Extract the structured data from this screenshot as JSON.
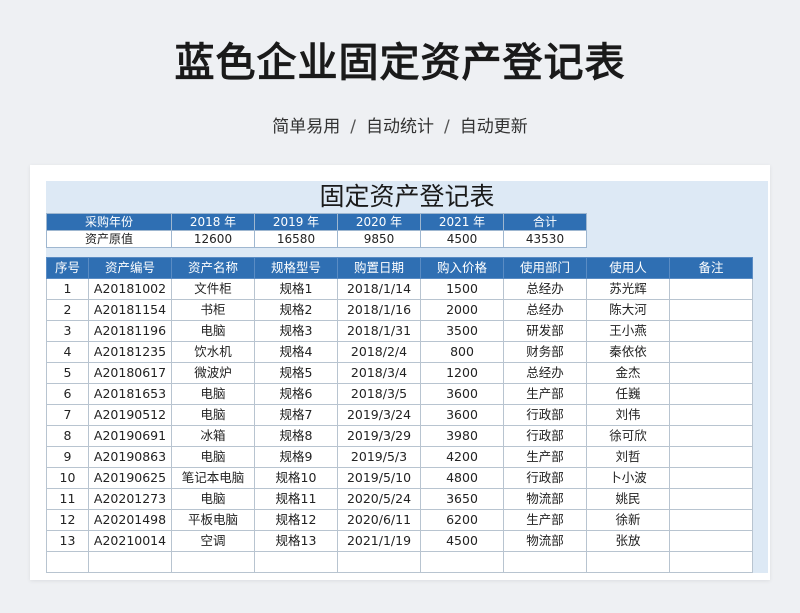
{
  "header": {
    "title": "蓝色企业固定资产登记表",
    "subtitle_parts": [
      "简单易用",
      "自动统计",
      "自动更新"
    ],
    "separator": "/"
  },
  "sheet": {
    "title": "固定资产登记表",
    "summary": {
      "header": [
        "采购年份",
        "2018 年",
        "2019 年",
        "2020 年",
        "2021 年",
        "合计"
      ],
      "values": [
        "资产原值",
        "12600",
        "16580",
        "9850",
        "4500",
        "43530"
      ]
    },
    "table": {
      "columns": [
        "序号",
        "资产编号",
        "资产名称",
        "规格型号",
        "购置日期",
        "购入价格",
        "使用部门",
        "使用人",
        "备注"
      ],
      "rows": [
        [
          "1",
          "A20181002",
          "文件柜",
          "规格1",
          "2018/1/14",
          "1500",
          "总经办",
          "苏光辉",
          ""
        ],
        [
          "2",
          "A20181154",
          "书柜",
          "规格2",
          "2018/1/16",
          "2000",
          "总经办",
          "陈大河",
          ""
        ],
        [
          "3",
          "A20181196",
          "电脑",
          "规格3",
          "2018/1/31",
          "3500",
          "研发部",
          "王小燕",
          ""
        ],
        [
          "4",
          "A20181235",
          "饮水机",
          "规格4",
          "2018/2/4",
          "800",
          "财务部",
          "秦依依",
          ""
        ],
        [
          "5",
          "A20180617",
          "微波炉",
          "规格5",
          "2018/3/4",
          "1200",
          "总经办",
          "金杰",
          ""
        ],
        [
          "6",
          "A20181653",
          "电脑",
          "规格6",
          "2018/3/5",
          "3600",
          "生产部",
          "任巍",
          ""
        ],
        [
          "7",
          "A20190512",
          "电脑",
          "规格7",
          "2019/3/24",
          "3600",
          "行政部",
          "刘伟",
          ""
        ],
        [
          "8",
          "A20190691",
          "冰箱",
          "规格8",
          "2019/3/29",
          "3980",
          "行政部",
          "徐可欣",
          ""
        ],
        [
          "9",
          "A20190863",
          "电脑",
          "规格9",
          "2019/5/3",
          "4200",
          "生产部",
          "刘哲",
          ""
        ],
        [
          "10",
          "A20190625",
          "笔记本电脑",
          "规格10",
          "2019/5/10",
          "4800",
          "行政部",
          "卜小波",
          ""
        ],
        [
          "11",
          "A20201273",
          "电脑",
          "规格11",
          "2020/5/24",
          "3650",
          "物流部",
          "姚民",
          ""
        ],
        [
          "12",
          "A20201498",
          "平板电脑",
          "规格12",
          "2020/6/11",
          "6200",
          "生产部",
          "徐新",
          ""
        ],
        [
          "13",
          "A20210014",
          "空调",
          "规格13",
          "2021/1/19",
          "4500",
          "物流部",
          "张放",
          ""
        ]
      ]
    }
  },
  "colors": {
    "header_blue": "#2f6fb3",
    "sheet_bg": "#dde9f5",
    "page_bg": "#eef0f3"
  }
}
